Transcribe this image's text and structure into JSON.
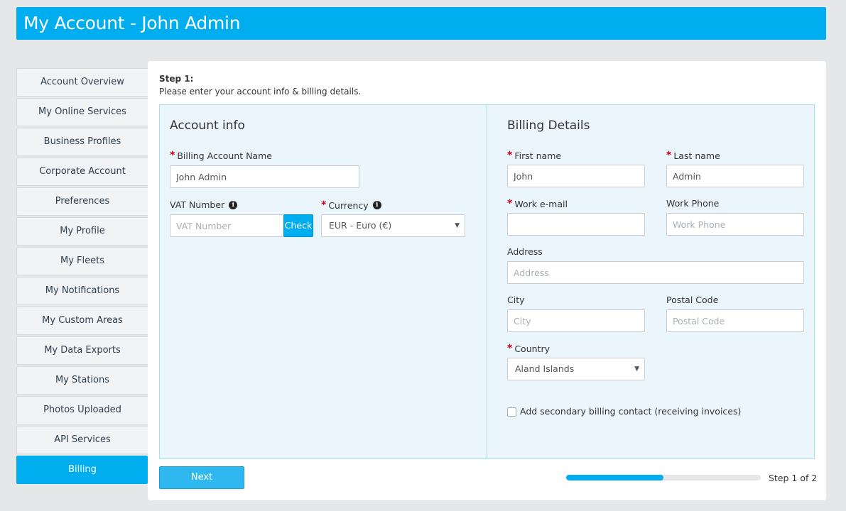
{
  "header": {
    "title": "My Account - John Admin"
  },
  "sidebar": {
    "items": [
      {
        "label": "Account Overview",
        "active": false
      },
      {
        "label": "My Online Services",
        "active": false
      },
      {
        "label": "Business Profiles",
        "active": false
      },
      {
        "label": "Corporate Account",
        "active": false
      },
      {
        "label": "Preferences",
        "active": false
      },
      {
        "label": "My Profile",
        "active": false
      },
      {
        "label": "My Fleets",
        "active": false
      },
      {
        "label": "My Notifications",
        "active": false
      },
      {
        "label": "My Custom Areas",
        "active": false
      },
      {
        "label": "My Data Exports",
        "active": false
      },
      {
        "label": "My Stations",
        "active": false
      },
      {
        "label": "Photos Uploaded",
        "active": false
      },
      {
        "label": "API Services",
        "active": false
      },
      {
        "label": "Billing",
        "active": true
      }
    ]
  },
  "step": {
    "title": "Step 1:",
    "description": "Please enter your account info & billing details."
  },
  "account_info": {
    "title": "Account info",
    "billing_account_name": {
      "label": "Billing Account Name",
      "value": "John Admin",
      "placeholder": ""
    },
    "vat_number": {
      "label": "VAT Number",
      "value": "",
      "placeholder": "VAT Number"
    },
    "check_button": "Check",
    "currency": {
      "label": "Currency",
      "selected": "EUR - Euro (€)"
    }
  },
  "billing_details": {
    "title": "Billing Details",
    "first_name": {
      "label": "First name",
      "value": "John",
      "placeholder": ""
    },
    "last_name": {
      "label": "Last name",
      "value": "Admin",
      "placeholder": ""
    },
    "work_email": {
      "label": "Work e-mail",
      "value": "",
      "placeholder": ""
    },
    "work_phone": {
      "label": "Work Phone",
      "value": "",
      "placeholder": "Work Phone"
    },
    "address": {
      "label": "Address",
      "value": "",
      "placeholder": "Address"
    },
    "city": {
      "label": "City",
      "value": "",
      "placeholder": "City"
    },
    "postal_code": {
      "label": "Postal Code",
      "value": "",
      "placeholder": "Postal Code"
    },
    "country": {
      "label": "Country",
      "selected": "Aland Islands"
    },
    "secondary_contact": {
      "label": "Add secondary billing contact (receiving invoices)",
      "checked": false
    }
  },
  "footer": {
    "next_button": "Next",
    "progress_fraction": 0.5,
    "step_count": "Step 1 of 2"
  },
  "colors": {
    "accent": "#00adef",
    "required": "#d0021b",
    "panel_bg": "#eaf6fc"
  },
  "icons": {
    "info": "info-icon",
    "dropdown": "caret-down-icon"
  }
}
